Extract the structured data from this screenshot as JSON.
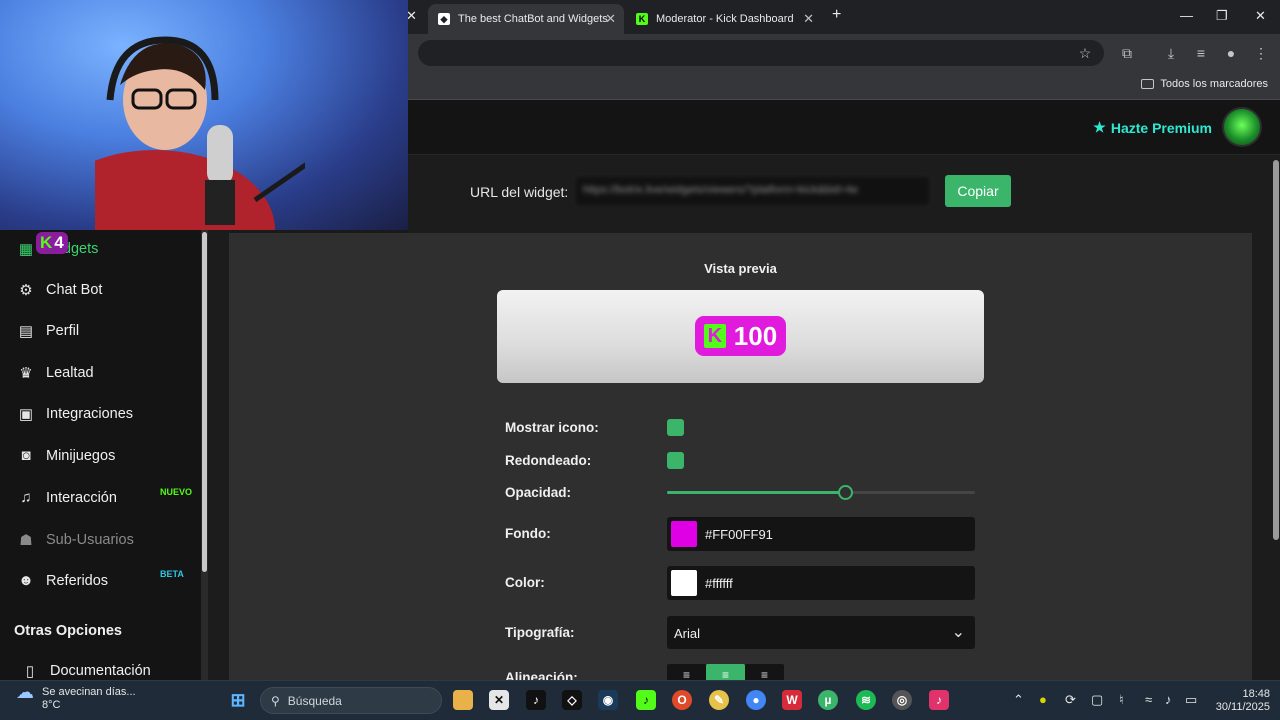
{
  "browser": {
    "tabs": [
      {
        "title": "The best ChatBot and Widgets"
      },
      {
        "title": "Moderator - Kick Dashboard"
      }
    ],
    "new_tab": "+",
    "bookmarks_label": "Todos los marcadores"
  },
  "header": {
    "premium_label": "Hazte Premium"
  },
  "widget_url": {
    "label": "URL del widget:",
    "value": "https://botrix.live/widgets/viewers/?platform=kick&bid=4e",
    "copy_label": "Copiar"
  },
  "sidebar": {
    "overlay_badge": "4",
    "items": [
      {
        "label": "Widgets",
        "icon": "grid-icon"
      },
      {
        "label": "Chat Bot",
        "icon": "robot-icon"
      },
      {
        "label": "Perfil",
        "icon": "id-card-icon"
      },
      {
        "label": "Lealtad",
        "icon": "trophy-icon"
      },
      {
        "label": "Integraciones",
        "icon": "discord-icon"
      },
      {
        "label": "Minijuegos",
        "icon": "gamepad-icon"
      },
      {
        "label": "Interacción",
        "icon": "music-icon",
        "badge": "NUEVO"
      },
      {
        "label": "Sub-Usuarios",
        "icon": "users-icon"
      },
      {
        "label": "Referidos",
        "icon": "user-group-icon",
        "badge": "BETA"
      }
    ],
    "section_title": "Otras Opciones",
    "docs_label": "Documentación"
  },
  "preview": {
    "title": "Vista previa",
    "value": "100",
    "background": "#e01bde",
    "icon_color": "#53fc18"
  },
  "form": {
    "show_icon_label": "Mostrar icono:",
    "rounded_label": "Redondeado:",
    "opacity_label": "Opacidad:",
    "opacity_value": 0.58,
    "background_label": "Fondo:",
    "background_value": "#FF00FF91",
    "background_swatch": "#e000e6",
    "color_label": "Color:",
    "color_value": "#ffffff",
    "font_label": "Tipografía:",
    "font_value": "Arial",
    "align_label": "Alineación:"
  },
  "taskbar": {
    "weather_text": "Se avecinan días...",
    "temperature": "8°C",
    "search_placeholder": "Búsqueda",
    "time": "18:48",
    "date": "30/11/2025"
  },
  "colors": {
    "accent_green": "#3bb56a",
    "premium_cyan": "#2ee8d0",
    "kick_green": "#53fc18",
    "badge_new": "#53fc18",
    "badge_beta": "#2ec4e6"
  }
}
